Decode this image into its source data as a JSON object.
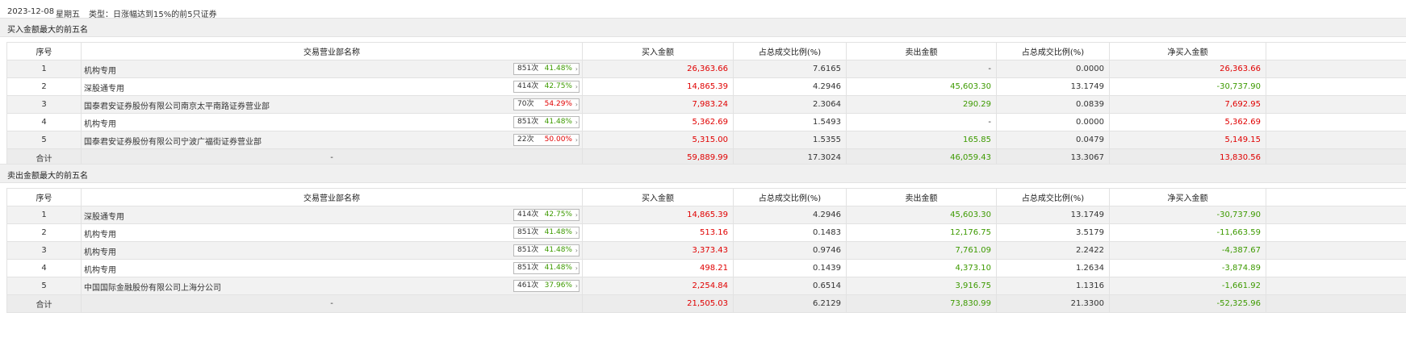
{
  "info": {
    "date": "2023-12-08",
    "weekday": "星期五",
    "type_text": "类型：日涨幅达到15%的前5只证券"
  },
  "colors": {
    "red": "#e00000",
    "green": "#3d9a00"
  },
  "columns": [
    "序号",
    "交易营业部名称",
    "买入金额",
    "占总成交比例(%)",
    "卖出金额",
    "占总成交比例(%)",
    "净买入金额"
  ],
  "buy_section": {
    "title": "买入金额最大的前五名",
    "rows": [
      {
        "idx": "1",
        "name": "机构专用",
        "count": "851次",
        "pct": "41.48%",
        "pct_color": "green",
        "buy": "26,363.66",
        "buy_ratio": "7.6165",
        "sell": "-",
        "sell_ratio": "0.0000",
        "net": "26,363.66",
        "net_color": "red"
      },
      {
        "idx": "2",
        "name": "深股通专用",
        "count": "414次",
        "pct": "42.75%",
        "pct_color": "green",
        "buy": "14,865.39",
        "buy_ratio": "4.2946",
        "sell": "45,603.30",
        "sell_ratio": "13.1749",
        "net": "-30,737.90",
        "net_color": "green"
      },
      {
        "idx": "3",
        "name": "国泰君安证券股份有限公司南京太平南路证券营业部",
        "count": "70次",
        "pct": "54.29%",
        "pct_color": "red",
        "buy": "7,983.24",
        "buy_ratio": "2.3064",
        "sell": "290.29",
        "sell_ratio": "0.0839",
        "net": "7,692.95",
        "net_color": "red"
      },
      {
        "idx": "4",
        "name": "机构专用",
        "count": "851次",
        "pct": "41.48%",
        "pct_color": "green",
        "buy": "5,362.69",
        "buy_ratio": "1.5493",
        "sell": "-",
        "sell_ratio": "0.0000",
        "net": "5,362.69",
        "net_color": "red"
      },
      {
        "idx": "5",
        "name": "国泰君安证券股份有限公司宁波广福街证券营业部",
        "count": "22次",
        "pct": "50.00%",
        "pct_color": "red",
        "buy": "5,315.00",
        "buy_ratio": "1.5355",
        "sell": "165.85",
        "sell_ratio": "0.0479",
        "net": "5,149.15",
        "net_color": "red"
      }
    ],
    "total": {
      "label": "合计",
      "dash": "-",
      "buy": "59,889.99",
      "buy_ratio": "17.3024",
      "sell": "46,059.43",
      "sell_ratio": "13.3067",
      "net": "13,830.56",
      "net_color": "red"
    }
  },
  "sell_section": {
    "title": "卖出金额最大的前五名",
    "rows": [
      {
        "idx": "1",
        "name": "深股通专用",
        "count": "414次",
        "pct": "42.75%",
        "pct_color": "green",
        "buy": "14,865.39",
        "buy_ratio": "4.2946",
        "sell": "45,603.30",
        "sell_ratio": "13.1749",
        "net": "-30,737.90",
        "net_color": "green"
      },
      {
        "idx": "2",
        "name": "机构专用",
        "count": "851次",
        "pct": "41.48%",
        "pct_color": "green",
        "buy": "513.16",
        "buy_ratio": "0.1483",
        "sell": "12,176.75",
        "sell_ratio": "3.5179",
        "net": "-11,663.59",
        "net_color": "green"
      },
      {
        "idx": "3",
        "name": "机构专用",
        "count": "851次",
        "pct": "41.48%",
        "pct_color": "green",
        "buy": "3,373.43",
        "buy_ratio": "0.9746",
        "sell": "7,761.09",
        "sell_ratio": "2.2422",
        "net": "-4,387.67",
        "net_color": "green"
      },
      {
        "idx": "4",
        "name": "机构专用",
        "count": "851次",
        "pct": "41.48%",
        "pct_color": "green",
        "buy": "498.21",
        "buy_ratio": "0.1439",
        "sell": "4,373.10",
        "sell_ratio": "1.2634",
        "net": "-3,874.89",
        "net_color": "green"
      },
      {
        "idx": "5",
        "name": "中国国际金融股份有限公司上海分公司",
        "count": "461次",
        "pct": "37.96%",
        "pct_color": "green",
        "buy": "2,254.84",
        "buy_ratio": "0.6514",
        "sell": "3,916.75",
        "sell_ratio": "1.1316",
        "net": "-1,661.92",
        "net_color": "green"
      }
    ],
    "total": {
      "label": "合计",
      "dash": "-",
      "buy": "21,505.03",
      "buy_ratio": "6.2129",
      "sell": "73,830.99",
      "sell_ratio": "21.3300",
      "net": "-52,325.96",
      "net_color": "green"
    }
  }
}
